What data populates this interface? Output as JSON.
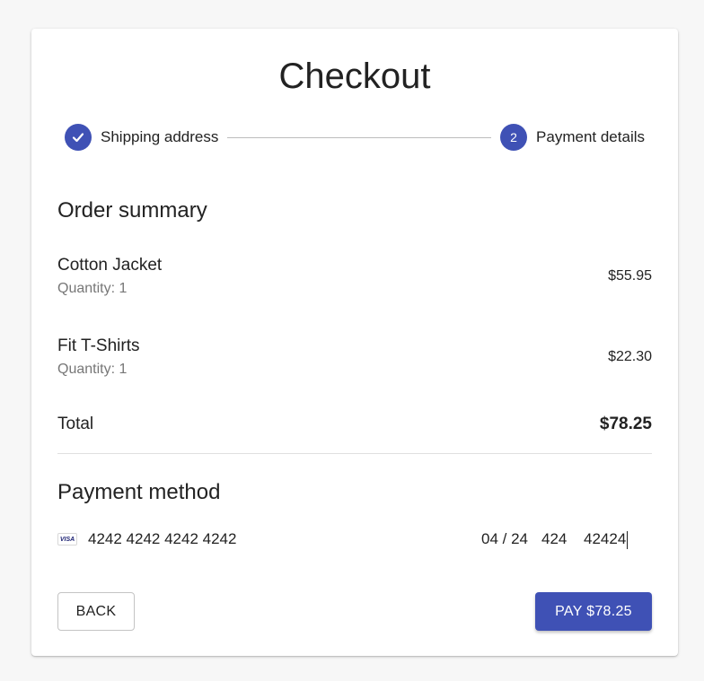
{
  "title": "Checkout",
  "stepper": {
    "steps": [
      {
        "label": "Shipping address",
        "state": "completed",
        "icon": "check-icon"
      },
      {
        "label": "Payment details",
        "state": "active",
        "number": "2"
      }
    ]
  },
  "order_summary": {
    "heading": "Order summary",
    "items": [
      {
        "name": "Cotton Jacket",
        "quantity": "Quantity: 1",
        "price": "$55.95"
      },
      {
        "name": "Fit T-Shirts",
        "quantity": "Quantity: 1",
        "price": "$22.30"
      }
    ],
    "total_label": "Total",
    "total_value": "$78.25"
  },
  "payment": {
    "heading": "Payment method",
    "card_brand": "VISA",
    "card_number": "4242 4242 4242 4242",
    "expiry": "04 / 24",
    "cvc": "424",
    "zip": "42424"
  },
  "actions": {
    "back_label": "BACK",
    "pay_label": "PAY $78.25"
  },
  "colors": {
    "primary": "#3f51b5",
    "background": "#f7f7f7",
    "card": "#ffffff",
    "muted_text": "#777777"
  }
}
